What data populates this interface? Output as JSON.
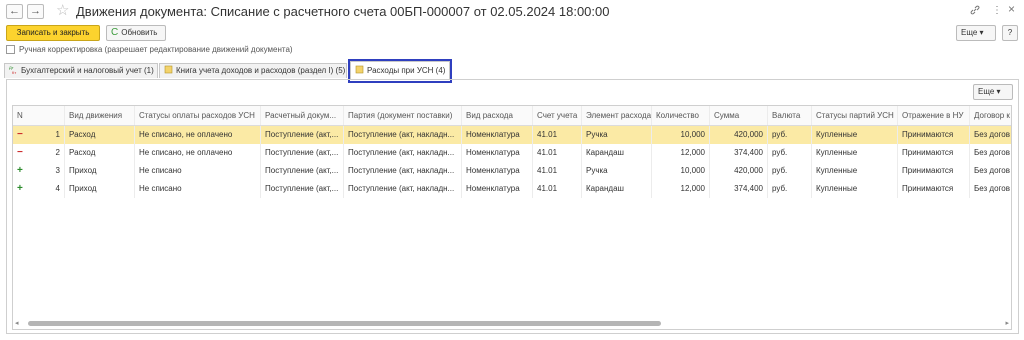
{
  "window": {
    "title": "Движения документа: Списание с расчетного счета 00БП-000007 от 02.05.2024 18:00:00",
    "back_icon": "←",
    "forward_icon": "→",
    "star_icon": "☆",
    "link_icon": "🔗",
    "menu_icon": "⋮",
    "close_icon": "×"
  },
  "toolbar": {
    "save_close": "Записать и закрыть",
    "refresh_icon": "C",
    "refresh": "Обновить",
    "more": "Еще",
    "more_arrow": "▾",
    "help": "?"
  },
  "manual_edit": {
    "label": "Ручная корректировка (разрешает редактирование движений документа)",
    "checked": false
  },
  "tabs": [
    {
      "label": "Бухгалтерский и налоговый учет (1)",
      "icon": "accounting-icon",
      "active": false
    },
    {
      "label": "Книга учета доходов и расходов (раздел I) (5)",
      "icon": "book-icon",
      "active": false
    },
    {
      "label": "Расходы при УСН (4)",
      "icon": "expenses-icon",
      "active": true
    }
  ],
  "grid_toolbar": {
    "more": "Еще",
    "more_arrow": "▾"
  },
  "grid": {
    "columns": [
      "N",
      "Вид движения",
      "Статусы оплаты расходов УСН",
      "Расчетный докум...",
      "Партия (документ поставки)",
      "Вид расхода",
      "Счет учета",
      "Элемент расхода",
      "Количество",
      "Сумма",
      "Валюта",
      "Статусы партий УСН",
      "Отражение в НУ",
      "Договор к"
    ],
    "rows": [
      {
        "sign": "−",
        "n": "1",
        "movement": "Расход",
        "pay_status": "Не списано, не оплачено",
        "settle_doc": "Поступление (акт,...",
        "batch": "Поступление (акт, накладн...",
        "expense_kind": "Номенклатура",
        "account": "41.01",
        "element": "Ручка",
        "qty": "10,000",
        "sum": "420,000",
        "currency": "руб.",
        "batch_status": "Купленные",
        "tax": "Принимаются",
        "contract": "Без догов"
      },
      {
        "sign": "−",
        "n": "2",
        "movement": "Расход",
        "pay_status": "Не списано, не оплачено",
        "settle_doc": "Поступление (акт,...",
        "batch": "Поступление (акт, накладн...",
        "expense_kind": "Номенклатура",
        "account": "41.01",
        "element": "Карандаш",
        "qty": "12,000",
        "sum": "374,400",
        "currency": "руб.",
        "batch_status": "Купленные",
        "tax": "Принимаются",
        "contract": "Без догов"
      },
      {
        "sign": "+",
        "n": "3",
        "movement": "Приход",
        "pay_status": "Не списано",
        "settle_doc": "Поступление (акт,...",
        "batch": "Поступление (акт, накладн...",
        "expense_kind": "Номенклатура",
        "account": "41.01",
        "element": "Ручка",
        "qty": "10,000",
        "sum": "420,000",
        "currency": "руб.",
        "batch_status": "Купленные",
        "tax": "Принимаются",
        "contract": "Без догов"
      },
      {
        "sign": "+",
        "n": "4",
        "movement": "Приход",
        "pay_status": "Не списано",
        "settle_doc": "Поступление (акт,...",
        "batch": "Поступление (акт, накладн...",
        "expense_kind": "Номенклатура",
        "account": "41.01",
        "element": "Карандаш",
        "qty": "12,000",
        "sum": "374,400",
        "currency": "руб.",
        "batch_status": "Купленные",
        "tax": "Принимаются",
        "contract": "Без догов"
      }
    ],
    "selected_row": 1
  },
  "scrollbar": {
    "left_arrow": "◂",
    "right_arrow": "▸"
  },
  "colors": {
    "primary_button": "#fcd32e",
    "selected_row": "#fbeaa5",
    "tab_highlight": "#2f3fbf",
    "minus": "#cc2a2a",
    "plus": "#2a8a2a"
  }
}
